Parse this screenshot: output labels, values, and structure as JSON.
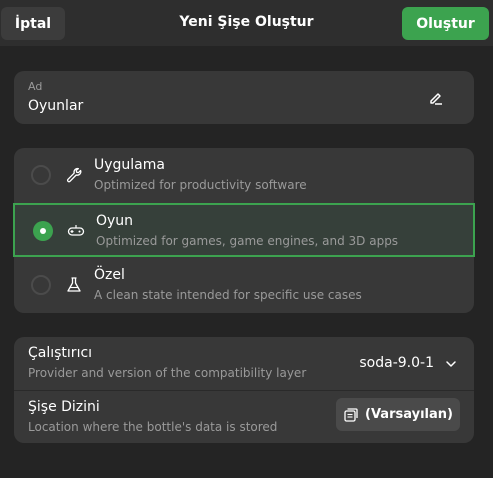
{
  "header": {
    "cancel_label": "İptal",
    "title": "Yeni Şişe Oluştur",
    "create_label": "Oluştur"
  },
  "name_field": {
    "label": "Ad",
    "value": "Oyunlar",
    "icon": "edit-icon"
  },
  "environments": [
    {
      "title": "Uygulama",
      "subtitle": "Optimized for productivity software",
      "icon": "wrench-icon",
      "selected": false
    },
    {
      "title": "Oyun",
      "subtitle": "Optimized for games, game engines, and 3D apps",
      "icon": "gamepad-icon",
      "selected": true
    },
    {
      "title": "Özel",
      "subtitle": "A clean state intended for specific use cases",
      "icon": "flask-icon",
      "selected": false
    }
  ],
  "settings": {
    "runner": {
      "title": "Çalıştırıcı",
      "subtitle": "Provider and version of the compatibility layer",
      "value": "soda-9.0-1"
    },
    "directory": {
      "title": "Şişe Dizini",
      "subtitle": "Location where the bottle's data is stored",
      "button_label": "(Varsayılan)"
    }
  },
  "colors": {
    "accent": "#3ca34f",
    "background": "#242424",
    "card": "#383838"
  }
}
